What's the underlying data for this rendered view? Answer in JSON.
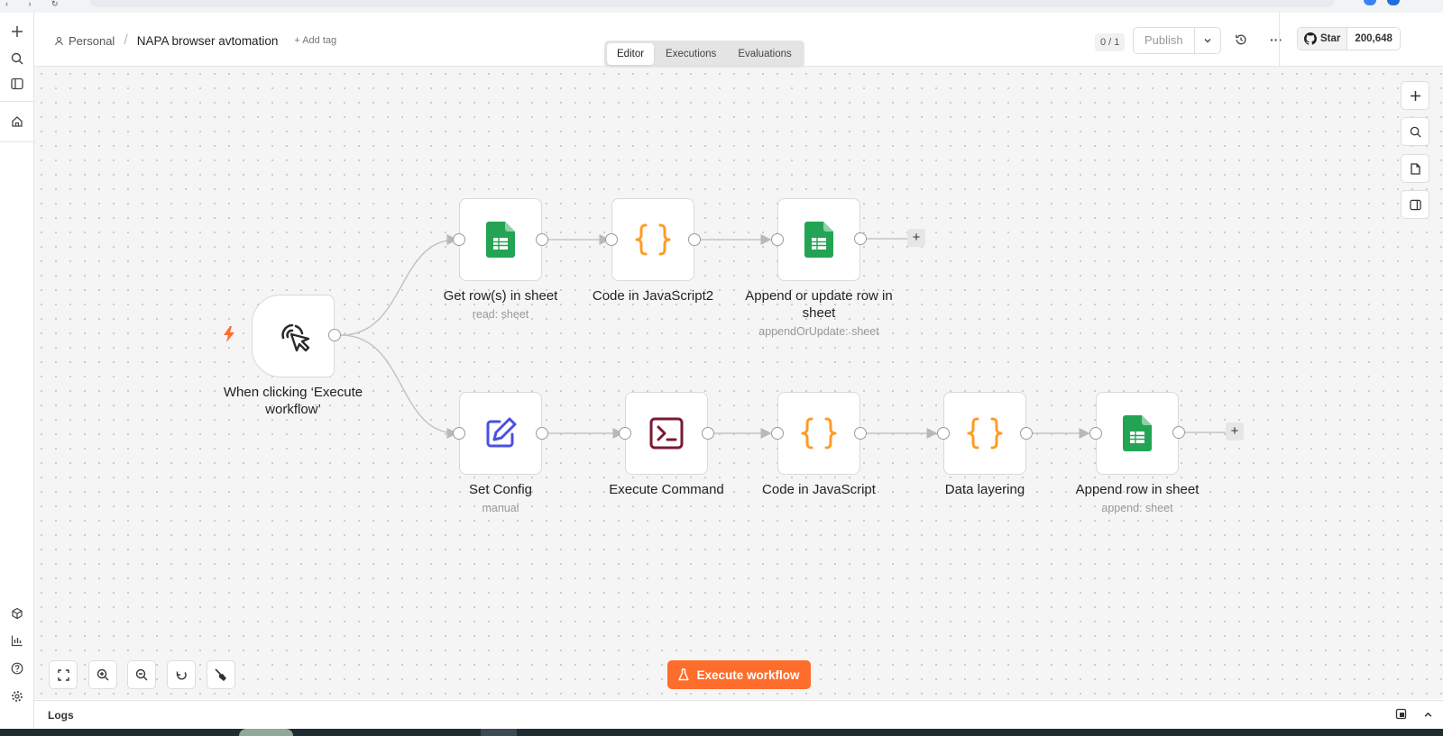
{
  "header": {
    "workspace": "Personal",
    "workflow_name": "NAPA browser avtomation",
    "add_tag": "+ Add tag",
    "counter": "0 / 1",
    "publish": "Publish",
    "github_star": "Star",
    "github_count": "200,648"
  },
  "tabs": [
    {
      "label": "Editor",
      "active": true
    },
    {
      "label": "Executions",
      "active": false
    },
    {
      "label": "Evaluations",
      "active": false
    }
  ],
  "nodes": {
    "trigger": {
      "label": "When clicking ‘Execute workflow’",
      "icon": "cursor-click-icon"
    },
    "get_rows": {
      "label": "Get row(s) in sheet",
      "sub": "read: sheet",
      "icon": "google-sheets-icon"
    },
    "code2": {
      "label": "Code in JavaScript2",
      "icon": "code-braces-icon"
    },
    "append_update": {
      "label": "Append or update row in sheet",
      "sub": "appendOrUpdate: sheet",
      "icon": "google-sheets-icon"
    },
    "set_config": {
      "label": "Set Config",
      "sub": "manual",
      "icon": "edit-pen-icon"
    },
    "exec_cmd": {
      "label": "Execute Command",
      "icon": "terminal-icon"
    },
    "code1": {
      "label": "Code in JavaScript",
      "icon": "code-braces-icon"
    },
    "data_layer": {
      "label": "Data layering",
      "icon": "code-braces-icon"
    },
    "append_row": {
      "label": "Append row in sheet",
      "sub": "append: sheet",
      "icon": "google-sheets-icon"
    }
  },
  "execute_button": "Execute workflow",
  "logs": {
    "label": "Logs"
  },
  "colors": {
    "accent": "#ff6d2c",
    "sheets_green": "#23a454",
    "code_orange": "#ff9b26",
    "set_blue": "#4a4fe3",
    "terminal_maroon": "#7a1a32"
  }
}
